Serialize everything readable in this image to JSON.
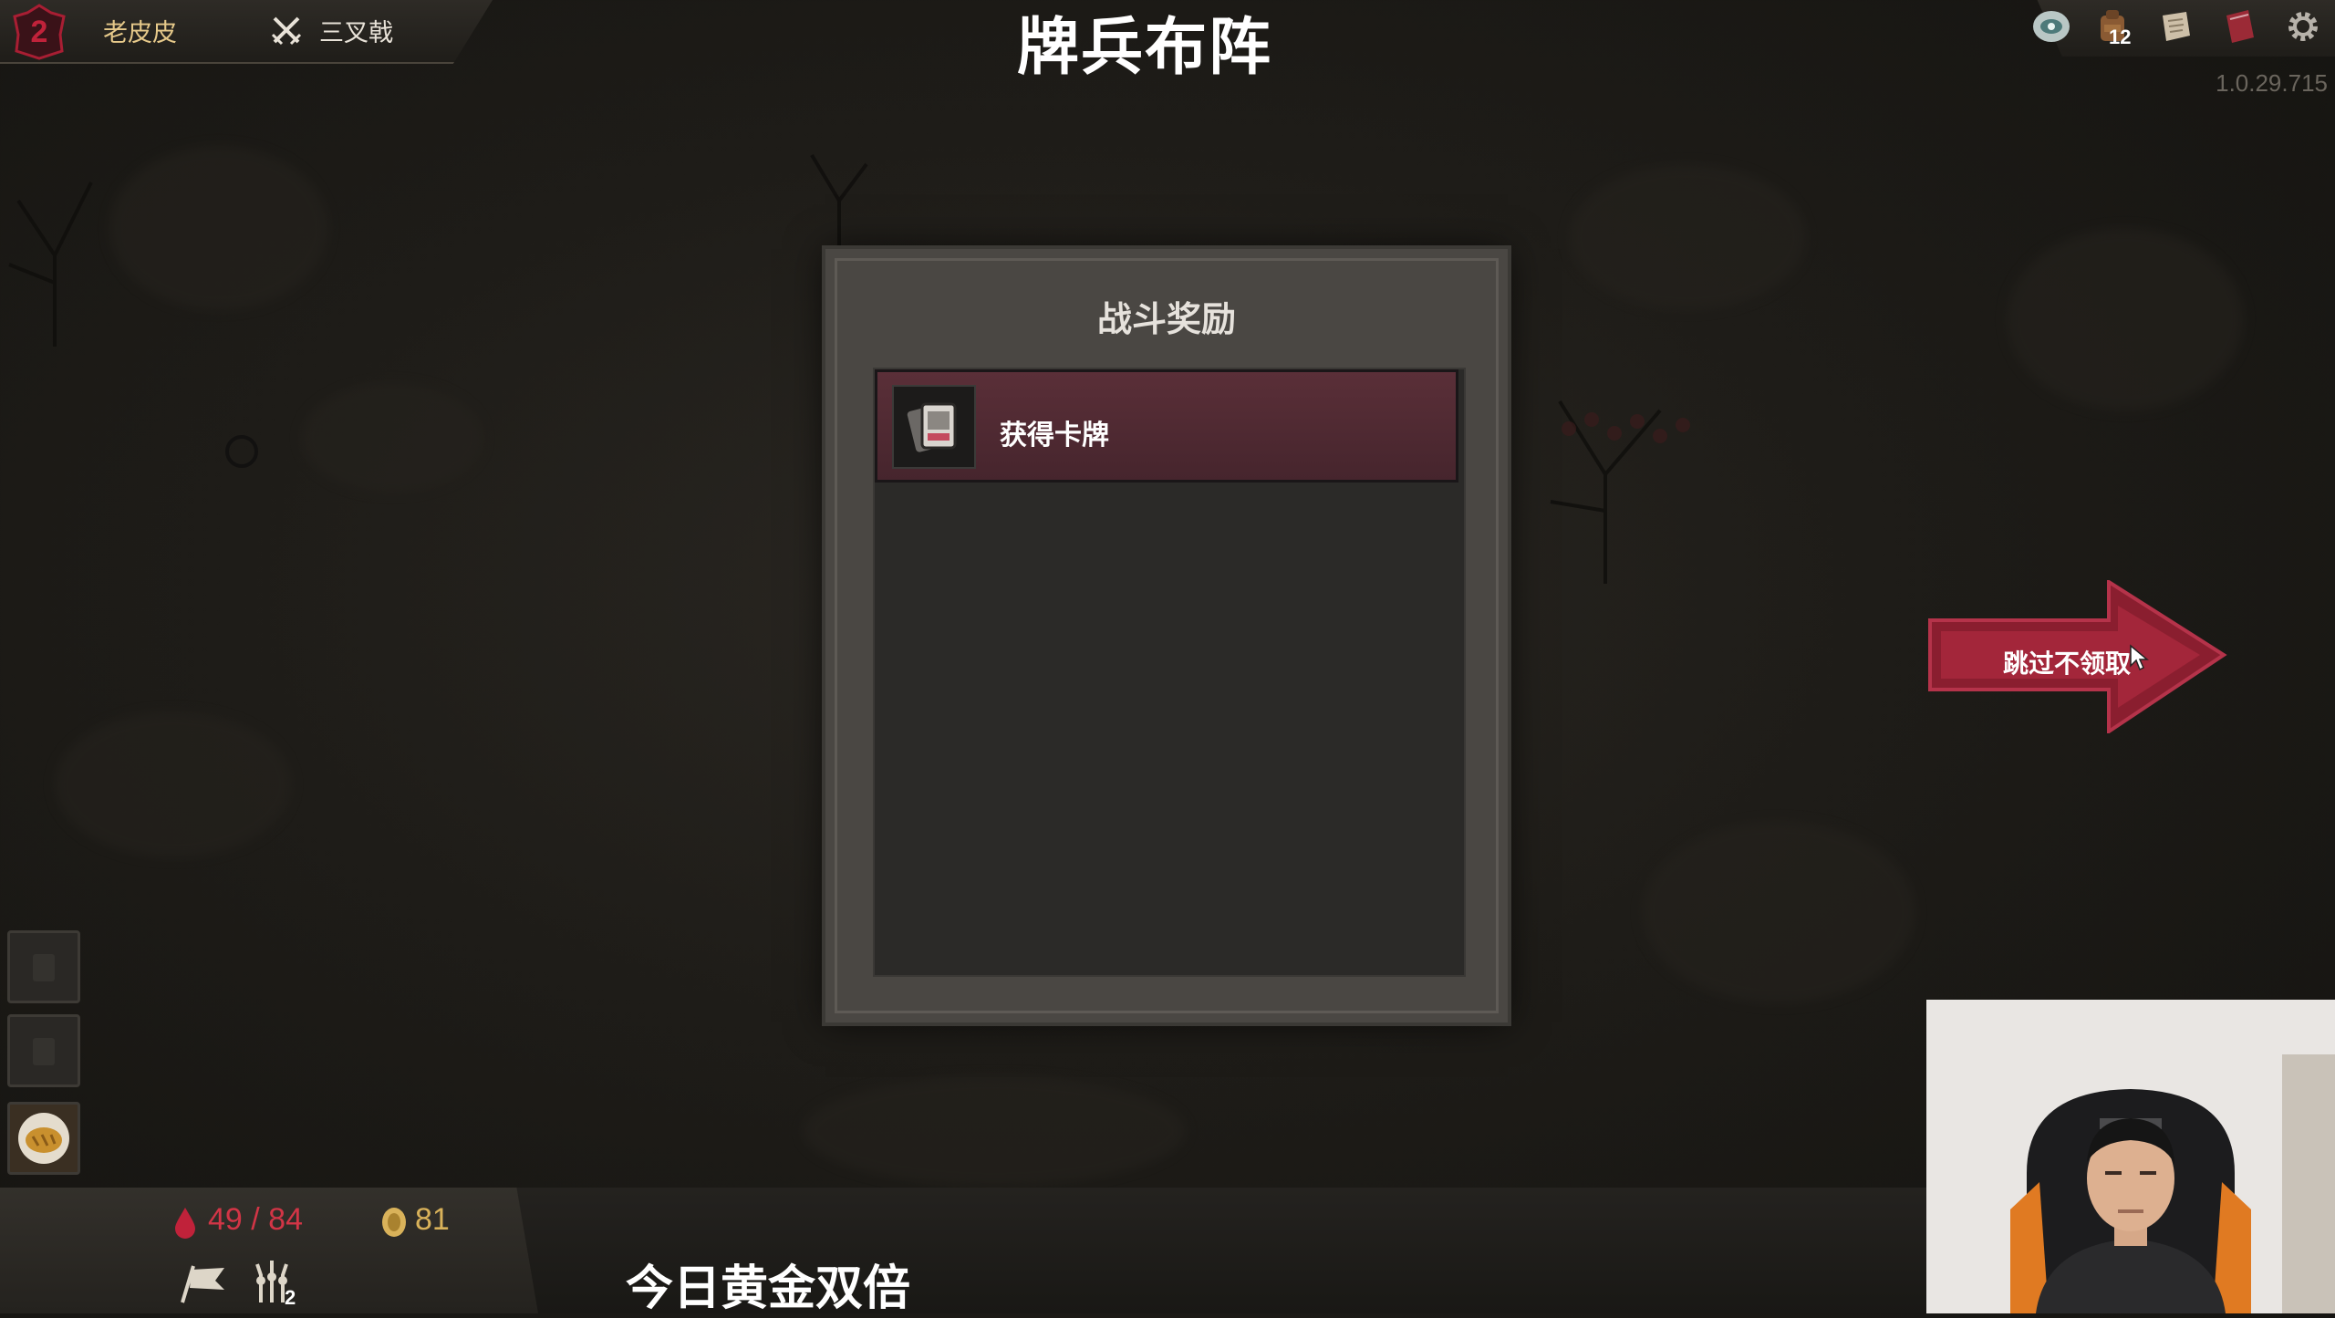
{
  "player": {
    "level": "2",
    "name": "老皮皮",
    "weapon": "三叉戟"
  },
  "header": {
    "title": "牌兵布阵",
    "version": "1.0.29.715"
  },
  "top_icons": [
    {
      "name": "eye-stone-icon"
    },
    {
      "name": "backpack-icon",
      "count": "12"
    },
    {
      "name": "scroll-icon"
    },
    {
      "name": "book-icon"
    },
    {
      "name": "settings-gear-icon"
    }
  ],
  "reward": {
    "title": "战斗奖励",
    "items": [
      {
        "label": "获得卡牌",
        "icon": "card-deck-icon"
      }
    ]
  },
  "skip_button": {
    "label": "跳过不领取"
  },
  "stats": {
    "hp": "49 / 84",
    "gold": "81",
    "troops": "2"
  },
  "stream": {
    "subtitle": "今日黄金双倍"
  },
  "colors": {
    "accent_red": "#c0223a",
    "panel": "#4a4743",
    "reward_item": "#5a2f38",
    "gold": "#d9b25a"
  }
}
